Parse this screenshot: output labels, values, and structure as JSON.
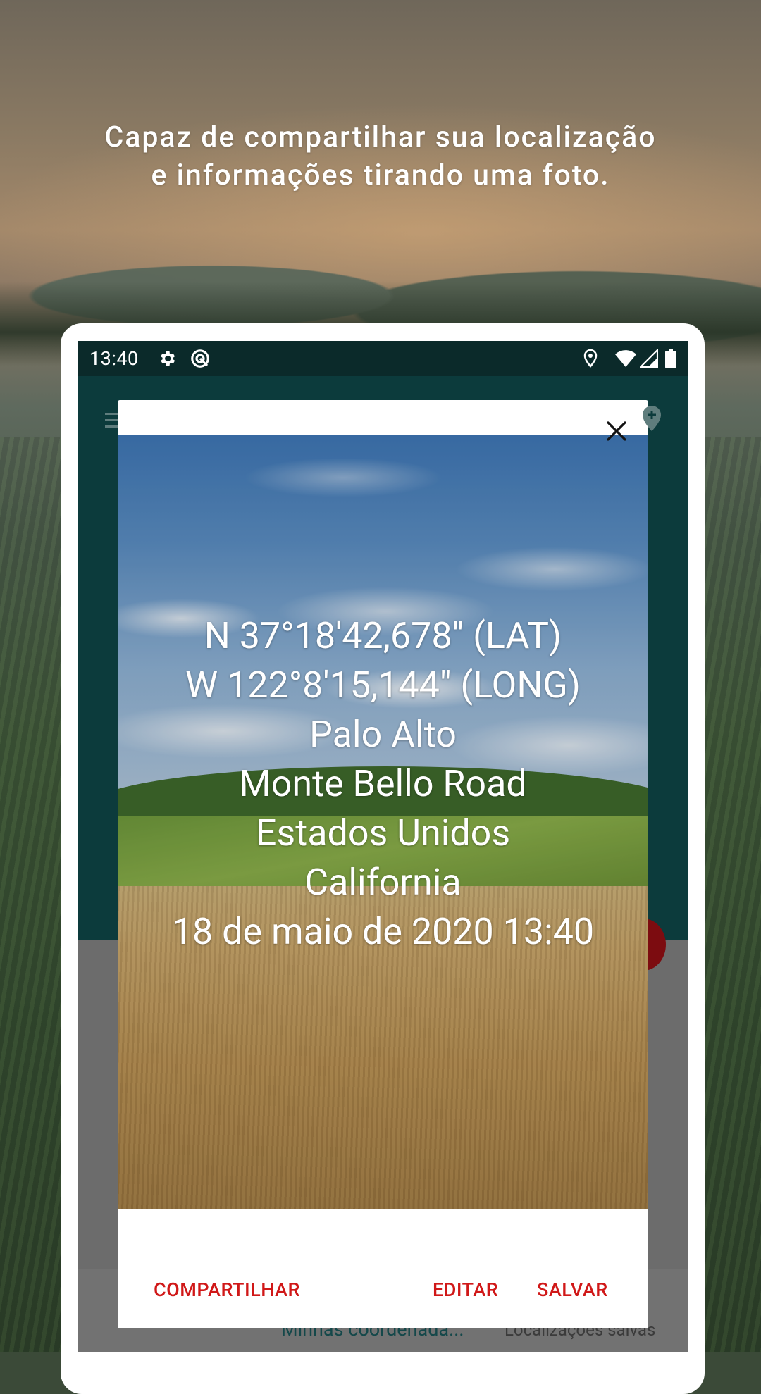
{
  "promo": {
    "headline": "Capaz de compartilhar sua localização e informações tirando uma foto."
  },
  "status_bar": {
    "time": "13:40",
    "left_icons": [
      "gear-icon",
      "sync-icon"
    ],
    "right_icons": [
      "location-pin-icon",
      "wifi-icon",
      "signal-icon",
      "battery-icon"
    ]
  },
  "app": {
    "toolbar_left_icon": "menu-icon",
    "toolbar_right_icon": "add-location-icon",
    "bottom_tabs": [
      "Minhas coordenada...",
      "Localizações salvas"
    ]
  },
  "dialog": {
    "close_icon": "close-icon",
    "info_lines": [
      "N 37°18'42,678\" (LAT)",
      "W 122°8'15,144\" (LONG)",
      "Palo Alto",
      "Monte Bello Road",
      "Estados Unidos",
      "California",
      "18 de maio de 2020 13:40"
    ],
    "buttons": {
      "share": "COMPARTILHAR",
      "edit": "EDITAR",
      "save": "SALVAR"
    }
  },
  "colors": {
    "accent_red": "#d01818",
    "app_teal": "#0c3b3c",
    "status_bar": "#0b2a2a",
    "fab_red": "#7c0c10"
  }
}
